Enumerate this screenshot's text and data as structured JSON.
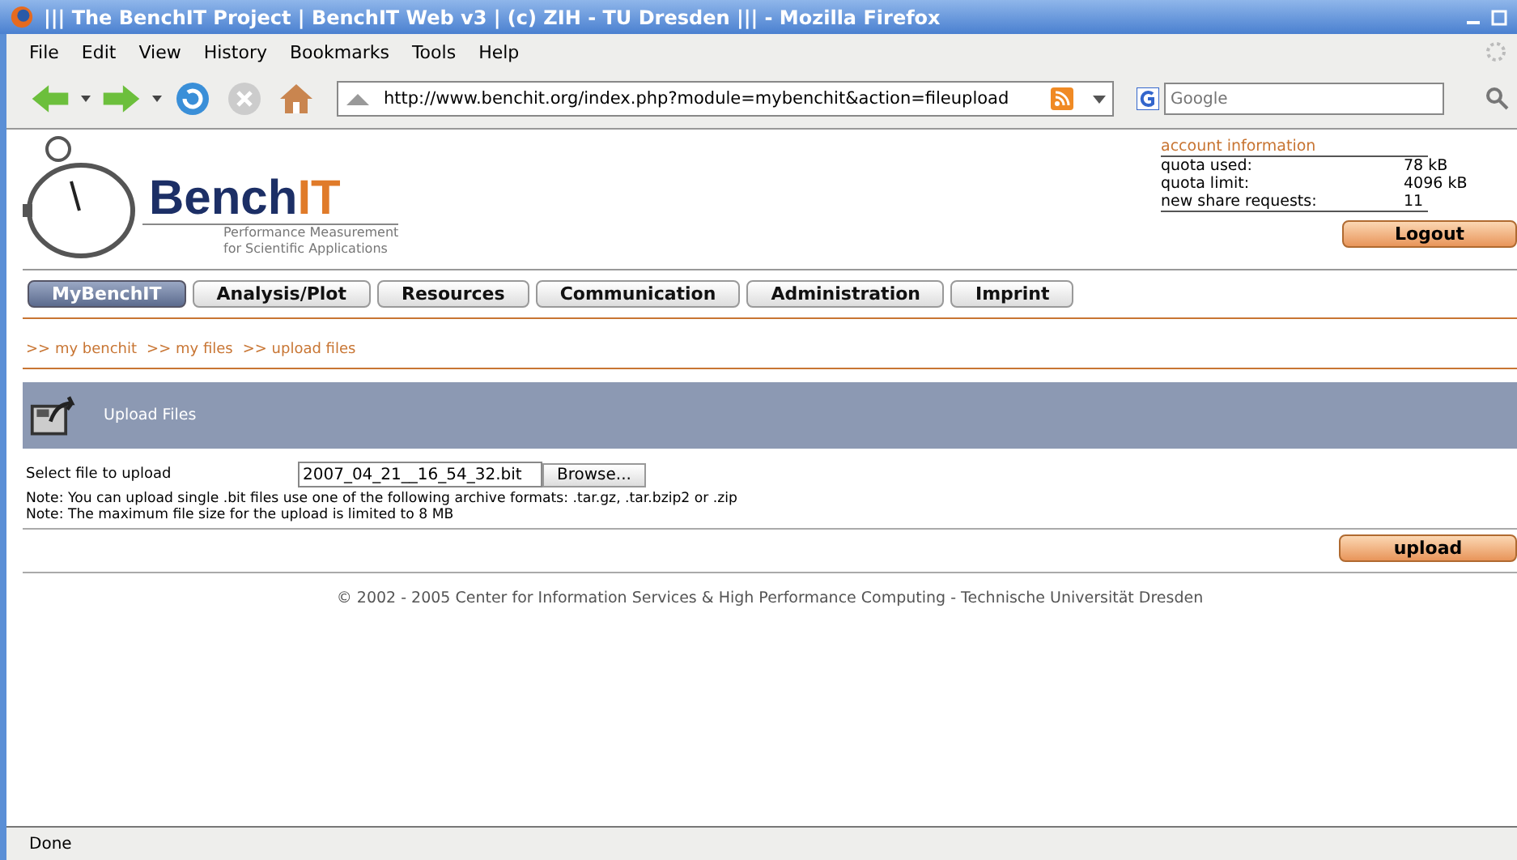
{
  "window": {
    "title": "||| The BenchIT Project | BenchIT Web v3 | (c) ZIH - TU Dresden ||| - Mozilla Firefox"
  },
  "menu": [
    "File",
    "Edit",
    "View",
    "History",
    "Bookmarks",
    "Tools",
    "Help"
  ],
  "address": {
    "value": "http://www.benchit.org/index.php?module=mybenchit&action=fileupload"
  },
  "search": {
    "placeholder": "Google"
  },
  "logo": {
    "wordmark": "Bench**IT**",
    "tagline": [
      "Performance Measurement",
      "for Scientific Applications"
    ]
  },
  "account": {
    "title": "account information",
    "rows": [
      {
        "label": "quota used:",
        "value": "78 kB"
      },
      {
        "label": "quota limit:",
        "value": "4096 kB"
      },
      {
        "label": "new share requests:",
        "value": "11"
      }
    ],
    "logout": "Logout"
  },
  "nav": [
    {
      "label": "MyBenchIT",
      "selected": true
    },
    {
      "label": "Analysis/Plot",
      "selected": false
    },
    {
      "label": "Resources",
      "selected": false
    },
    {
      "label": "Communication",
      "selected": false
    },
    {
      "label": "Administration",
      "selected": false
    },
    {
      "label": "Imprint",
      "selected": false
    }
  ],
  "breadcrumb": [
    ">> my benchit",
    ">> my files",
    ">> upload files"
  ],
  "section": {
    "title": "Upload Files"
  },
  "form": {
    "label": "Select file to upload",
    "file": "2007_04_21__16_54_32.bit",
    "browse": "Browse...",
    "notes": [
      "Note: You can upload single .bit files use one of the following archive formats: .tar.gz, .tar.bzip2 or .zip",
      "Note: The maximum file size for the upload is limited to 8 MB"
    ],
    "submit": "upload"
  },
  "footer": "© 2002 - 2005 Center for Information Services & High Performance Computing - Technische Universität Dresden",
  "status_bar": "Done"
}
